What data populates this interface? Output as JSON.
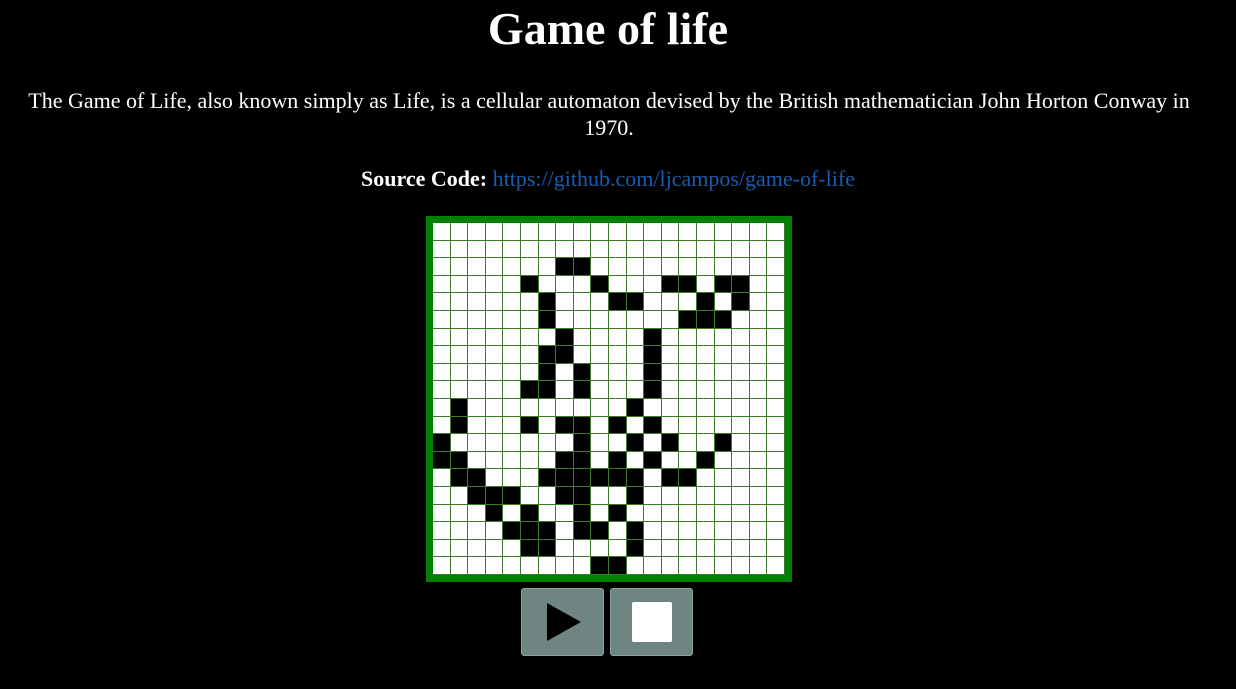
{
  "title": "Game of life",
  "description": "The Game of Life, also known simply as Life, is a cellular automaton devised by the British mathematician John Horton Conway in 1970.",
  "source": {
    "label": "Source Code:",
    "link_text": "https://github.com/ljcampos/game-of-life"
  },
  "board": {
    "rows": 20,
    "cols": 20,
    "live_color": "#000000",
    "dead_color": "#ffffff",
    "border_color": "#008000",
    "grid": [
      "00000000000000000000",
      "00000000000000000000",
      "00000001100000000000",
      "00000100010001101100",
      "00000010001100010100",
      "00000010000000111000",
      "00000001000010000000",
      "00000011000010000000",
      "00000010100010000000",
      "00000110100010000000",
      "01000000000100000000",
      "01000101101010000000",
      "10000000100101001000",
      "11000001101010010000",
      "01100011111101100000",
      "00111001100100000000",
      "00010100101000000000",
      "00001110110100000000",
      "00000110000100000000",
      "00000000011000000000"
    ]
  },
  "controls": {
    "play_icon": "play-icon",
    "stop_icon": "stop-icon",
    "button_color": "#6f8582"
  }
}
